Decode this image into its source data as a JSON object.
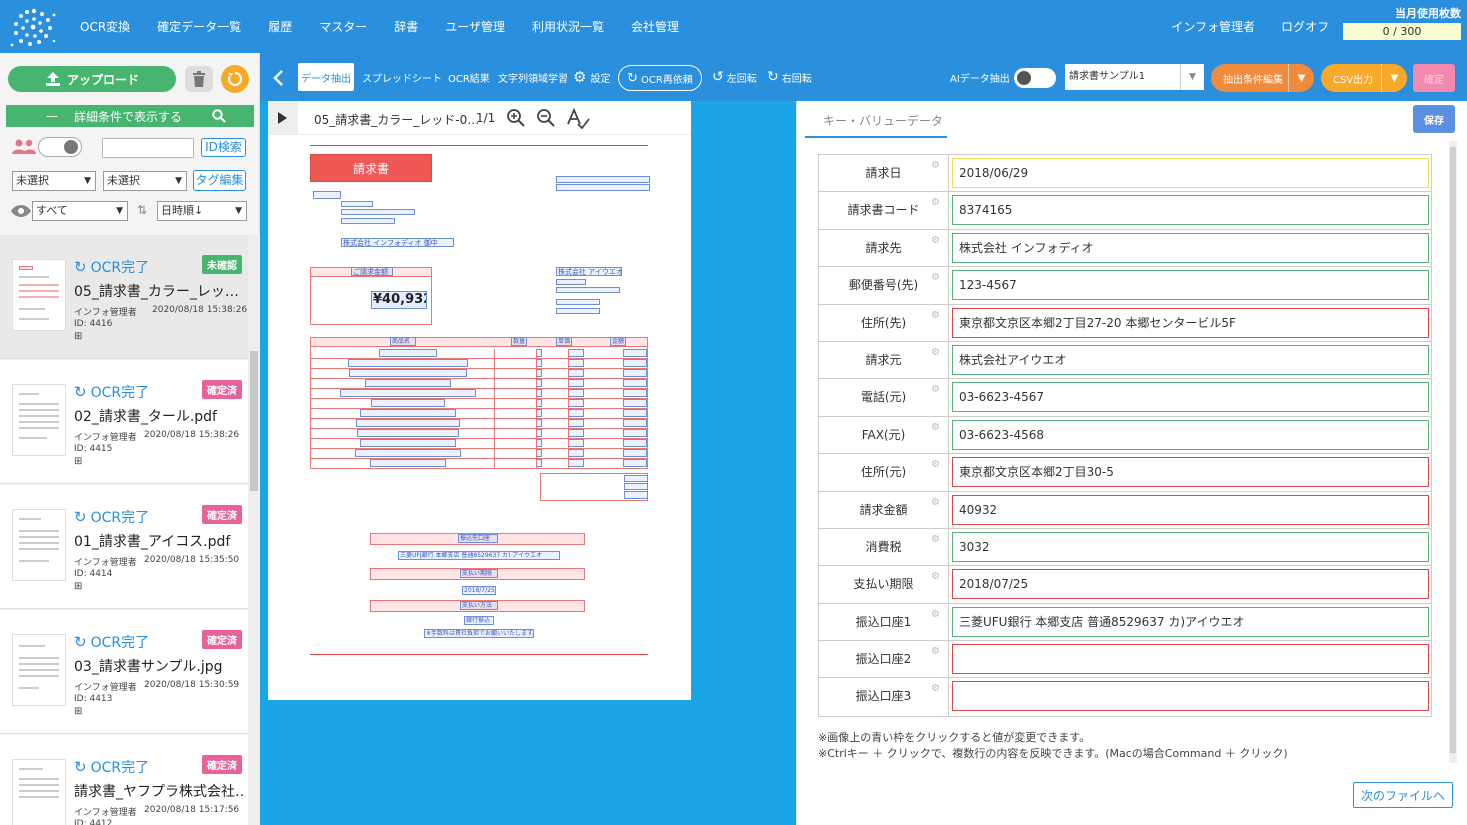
{
  "header": {
    "nav": [
      "OCR変換",
      "確定データ一覧",
      "履歴",
      "マスター",
      "辞書",
      "ユーザ管理",
      "利用状況一覧",
      "会社管理"
    ],
    "user": "インフォ管理者",
    "logout": "ログオフ",
    "usage_label": "当月使用枚数",
    "usage_value": "0 / 300"
  },
  "sidebar": {
    "upload": "アップロード",
    "filter_label": "詳細条件で表示する",
    "id_search": "ID検索",
    "select1": "未選択",
    "select2": "未選択",
    "tag_edit": "タグ編集",
    "view_select": "すべて",
    "sort_select": "日時順↓",
    "files": [
      {
        "status": "OCR完了",
        "badge": "未確認",
        "name": "05_請求書_カラー_レッ…",
        "user": "インフォ管理者",
        "date": "2020/08/18 15:38:26",
        "id": "ID: 4416"
      },
      {
        "status": "OCR完了",
        "badge": "確定済",
        "name": "02_請求書_タール.pdf",
        "user": "インフォ管理者",
        "date": "2020/08/18 15:38:26",
        "id": "ID: 4415"
      },
      {
        "status": "OCR完了",
        "badge": "確定済",
        "name": "01_請求書_アイコス.pdf",
        "user": "インフォ管理者",
        "date": "2020/08/18 15:35:50",
        "id": "ID: 4414"
      },
      {
        "status": "OCR完了",
        "badge": "確定済",
        "name": "03_請求書サンプル.jpg",
        "user": "インフォ管理者",
        "date": "2020/08/18 15:30:59",
        "id": "ID: 4413"
      },
      {
        "status": "OCR完了",
        "badge": "確定済",
        "name": "請求書_ヤフプラ株式会社…",
        "user": "インフォ管理者",
        "date": "2020/08/18 15:17:56",
        "id": "ID: 4412"
      }
    ]
  },
  "toolbar": {
    "data_extract": "データ抽出",
    "spreadsheet": "スプレッドシート",
    "ocr_result": "OCR結果",
    "char_learn": "文字列領域学習",
    "settings": "設定",
    "ocr_retry": "OCR再依頼",
    "rotate_left": "左回転",
    "rotate_right": "右回転",
    "ai_extract": "AIデータ抽出",
    "template": "請求書サンプル1",
    "extract_edit": "抽出条件編集",
    "csv_out": "CSV出力",
    "confirm": "確定"
  },
  "document": {
    "title": "05_請求書_カラー_レッド-0…",
    "page": "1/1",
    "invoice_title": "請求書",
    "amount_label": "ご請求金額",
    "amount": "¥40,932",
    "company_to": "株式会社 インフォディオ 御中",
    "company_from": "株式会社 アイウエオ",
    "table_headers": [
      "商品名",
      "数量",
      "単価",
      "金額"
    ],
    "bank_label": "振込先口座",
    "bank": "三菱UFJ銀行 本郷支店 普通8529637 カ) アイウエオ",
    "due_label": "支払い期限",
    "due": "2018/7/25",
    "method_label": "支払い方法",
    "method": "銀行振込",
    "fee_note": "※手数料は貴社負担でお願いいたします。"
  },
  "kv": {
    "tab": "キー・バリューデータ",
    "save": "保存",
    "rows": [
      {
        "key": "請求日",
        "value": "2018/06/29",
        "state": "focus"
      },
      {
        "key": "請求書コード",
        "value": "8374165",
        "state": "ok"
      },
      {
        "key": "請求先",
        "value": "株式会社 インフォディオ",
        "state": "ok"
      },
      {
        "key": "郵便番号(先)",
        "value": "123-4567",
        "state": "ok"
      },
      {
        "key": "住所(先)",
        "value": "東京都文京区本郷2丁目27-20 本郷センタービル5F",
        "state": "ng"
      },
      {
        "key": "請求元",
        "value": "株式会社アイウエオ",
        "state": "ok"
      },
      {
        "key": "電話(元)",
        "value": "03-6623-4567",
        "state": "ok"
      },
      {
        "key": "FAX(元)",
        "value": "03-6623-4568",
        "state": "ok"
      },
      {
        "key": "住所(元)",
        "value": "東京都文京区本郷2丁目30-5",
        "state": "ng"
      },
      {
        "key": "請求金額",
        "value": "40932",
        "state": "ng"
      },
      {
        "key": "消費税",
        "value": "3032",
        "state": "ok"
      },
      {
        "key": "支払い期限",
        "value": "2018/07/25",
        "state": "ng"
      },
      {
        "key": "振込口座1",
        "value": "三菱UFU銀行 本郷支店 普通8529637 カ)アイウエオ",
        "state": "ok"
      },
      {
        "key": "振込口座2",
        "value": "",
        "state": "ng"
      },
      {
        "key": "振込口座3",
        "value": "",
        "state": "ng"
      }
    ],
    "note1": "※画像上の青い枠をクリックすると値が変更できます。",
    "note2": "※Ctrlキー ＋ クリックで、複数行の内容を反映できます。(Macの場合Command ＋ クリック)",
    "next_file": "次のファイルへ"
  },
  "colors": {
    "brand": "#2a8fdc",
    "green": "#47b56f",
    "orange": "#f08a3c",
    "amber": "#f7a92a",
    "pink": "#f28ab0",
    "ok": "#5ab07a",
    "ng": "#e04848",
    "focus": "#f0e060"
  }
}
